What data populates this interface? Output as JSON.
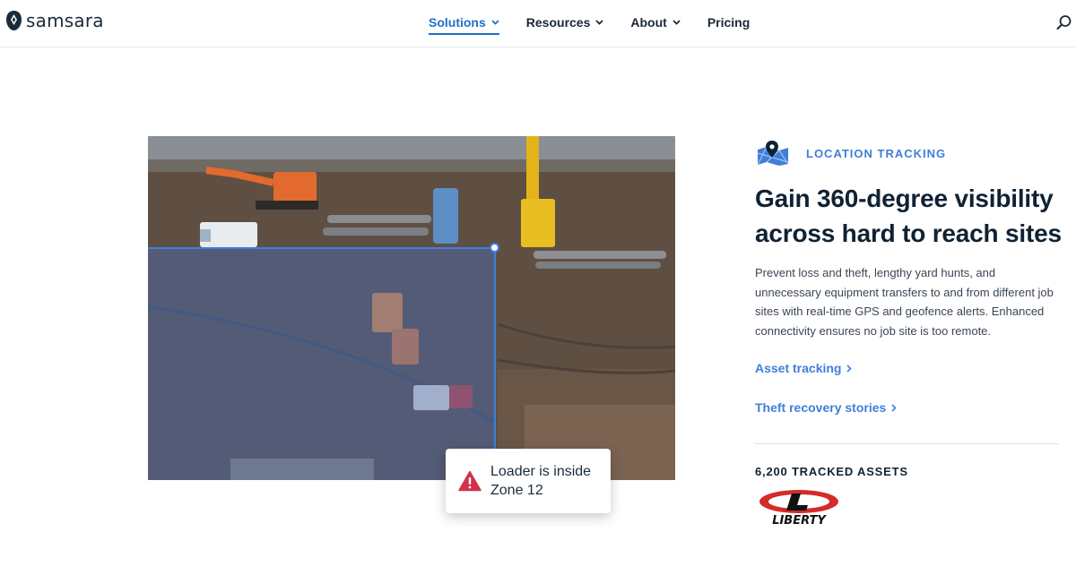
{
  "nav": {
    "brand": "samsara",
    "items": [
      {
        "label": "Solutions",
        "has_dropdown": true,
        "active": true
      },
      {
        "label": "Resources",
        "has_dropdown": true,
        "active": false
      },
      {
        "label": "About",
        "has_dropdown": true,
        "active": false
      },
      {
        "label": "Pricing",
        "has_dropdown": false,
        "active": false
      }
    ],
    "search_icon": "search-icon"
  },
  "hero": {
    "image_subject": "Aerial view of construction site with geofence zone",
    "alert": {
      "icon": "warning-triangle-icon",
      "text": "Loader is inside Zone 12"
    }
  },
  "feature": {
    "eyebrow_icon": "map-pin-icon",
    "eyebrow": "LOCATION TRACKING",
    "headline": "Gain 360-degree visibility across hard to reach sites",
    "body": "Prevent loss and theft, lengthy yard hunts, and unnecessary equipment transfers to and from different job sites with real-time GPS and geofence alerts. Enhanced connectivity ensures no job site is too remote.",
    "links": [
      {
        "label": "Asset tracking"
      },
      {
        "label": "Theft recovery stories"
      }
    ],
    "stat": "6,200 TRACKED ASSETS",
    "customer_logo": "LIBERTY"
  },
  "colors": {
    "accent": "#3f7fd8",
    "nav_active": "#1f6fc5",
    "heading": "#0f2233",
    "alert_red": "#d0334a",
    "zone_blue": "#3d7fe0"
  }
}
